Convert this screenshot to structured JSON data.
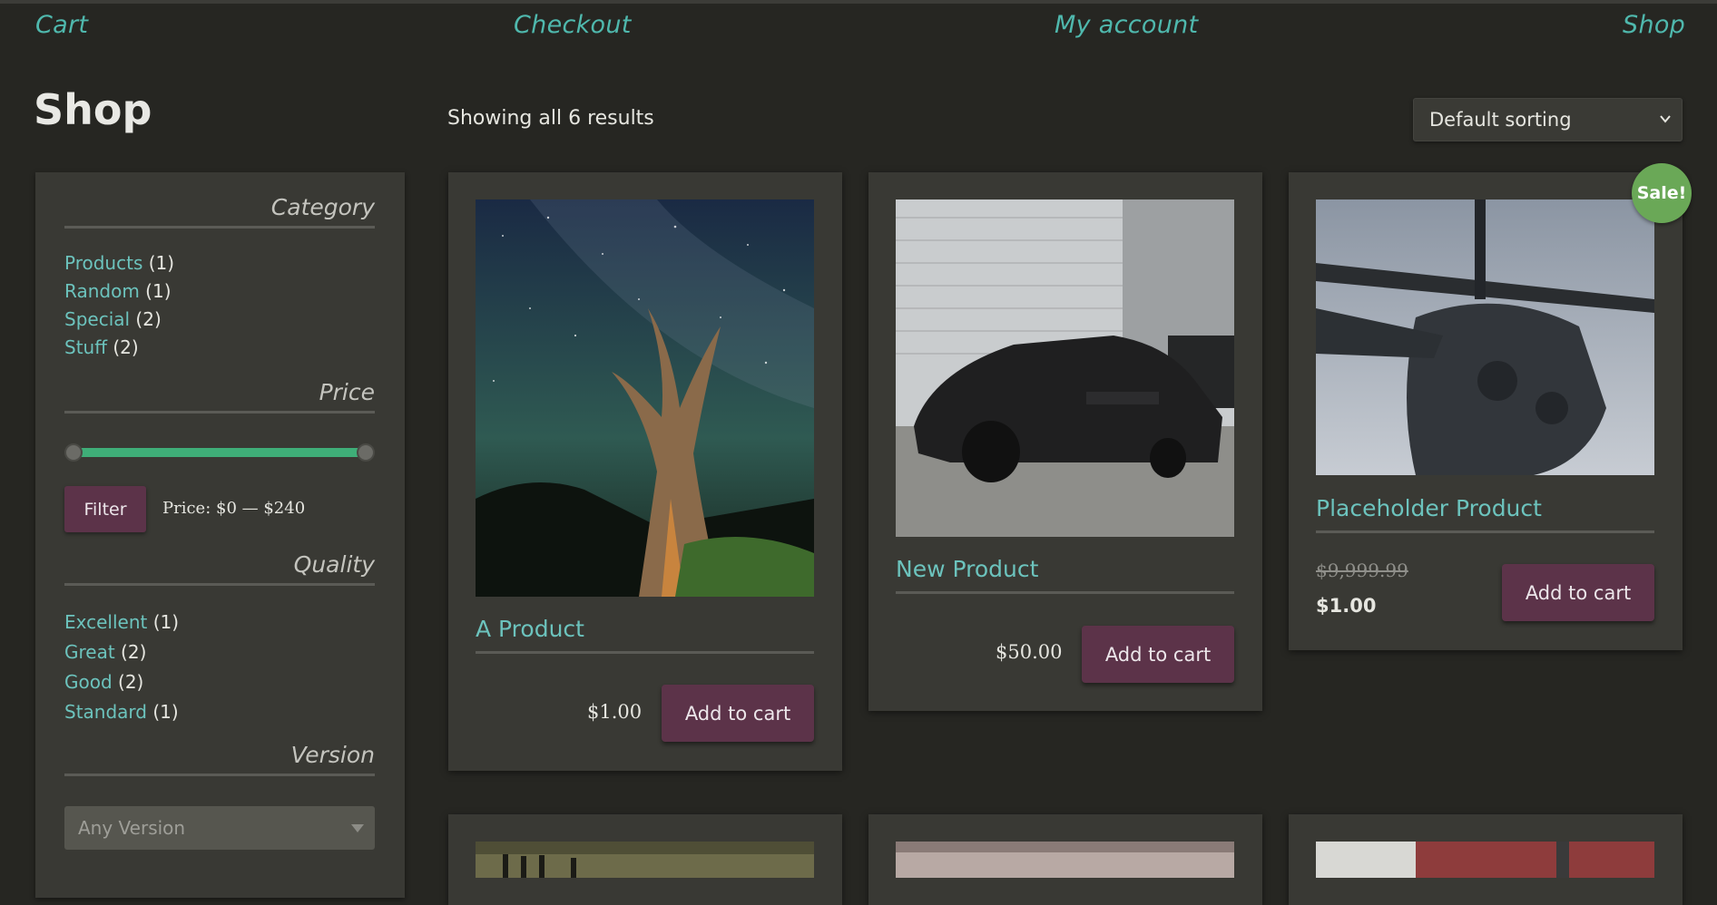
{
  "nav": {
    "cart": "Cart",
    "checkout": "Checkout",
    "my_account": "My account",
    "shop": "Shop"
  },
  "page_title": "Shop",
  "result_count": "Showing all 6 results",
  "sorting": {
    "selected": "Default sorting"
  },
  "sidebar": {
    "category_title": "Category",
    "categories": [
      {
        "label": "Products",
        "count": "(1)"
      },
      {
        "label": "Random",
        "count": "(1)"
      },
      {
        "label": "Special",
        "count": "(2)"
      },
      {
        "label": "Stuff",
        "count": "(2)"
      }
    ],
    "price_title": "Price",
    "price_range_fraction": [
      0,
      1
    ],
    "filter_label": "Filter",
    "price_text": "Price: $0 — $240",
    "quality_title": "Quality",
    "qualities": [
      {
        "label": "Excellent",
        "count": "(1)"
      },
      {
        "label": "Great",
        "count": "(2)"
      },
      {
        "label": "Good",
        "count": "(2)"
      },
      {
        "label": "Standard",
        "count": "(1)"
      }
    ],
    "version_title": "Version",
    "version_placeholder": "Any Version"
  },
  "products": [
    {
      "title": "A Product",
      "price": "$1.00",
      "button": "Add to cart"
    },
    {
      "title": "New Product",
      "price": "$50.00",
      "button": "Add to cart"
    },
    {
      "title": "Placeholder Product",
      "old_price": "$9,999.99",
      "price": "$1.00",
      "button": "Add to cart",
      "badge": "Sale!"
    }
  ],
  "colors": {
    "background": "#262622",
    "panel": "#393934",
    "link": "#6cc3bd",
    "nav_link": "#4fb8ad",
    "button": "#5c3349",
    "sale_badge": "#6aa857",
    "slider": "#3fae78"
  }
}
